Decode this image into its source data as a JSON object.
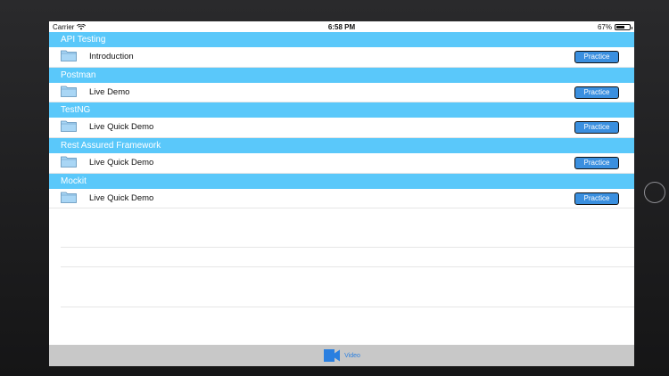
{
  "status_bar": {
    "carrier": "Carrier",
    "time": "6:58 PM",
    "battery": "67%",
    "battery_level": 0.67
  },
  "sections": [
    {
      "title": "API Testing",
      "rows": [
        {
          "label": "Introduction",
          "button": "Practice"
        }
      ]
    },
    {
      "title": "Postman",
      "rows": [
        {
          "label": "Live Demo",
          "button": "Practice"
        }
      ]
    },
    {
      "title": "TestNG",
      "rows": [
        {
          "label": "Live Quick Demo",
          "button": "Practice"
        }
      ]
    },
    {
      "title": "Rest Assured Framework",
      "rows": [
        {
          "label": "Live Quick Demo",
          "button": "Practice"
        }
      ]
    },
    {
      "title": "Mockit",
      "rows": [
        {
          "label": "Live Quick Demo",
          "button": "Practice"
        }
      ]
    }
  ],
  "tab_bar": {
    "items": [
      {
        "label": "Video",
        "icon": "video-camera-icon"
      }
    ]
  },
  "colors": {
    "section_header": "#5ac8fa",
    "button": "#3a8fdf",
    "tab_bar": "#c8c8c8",
    "tab_label": "#2a7fe0"
  }
}
